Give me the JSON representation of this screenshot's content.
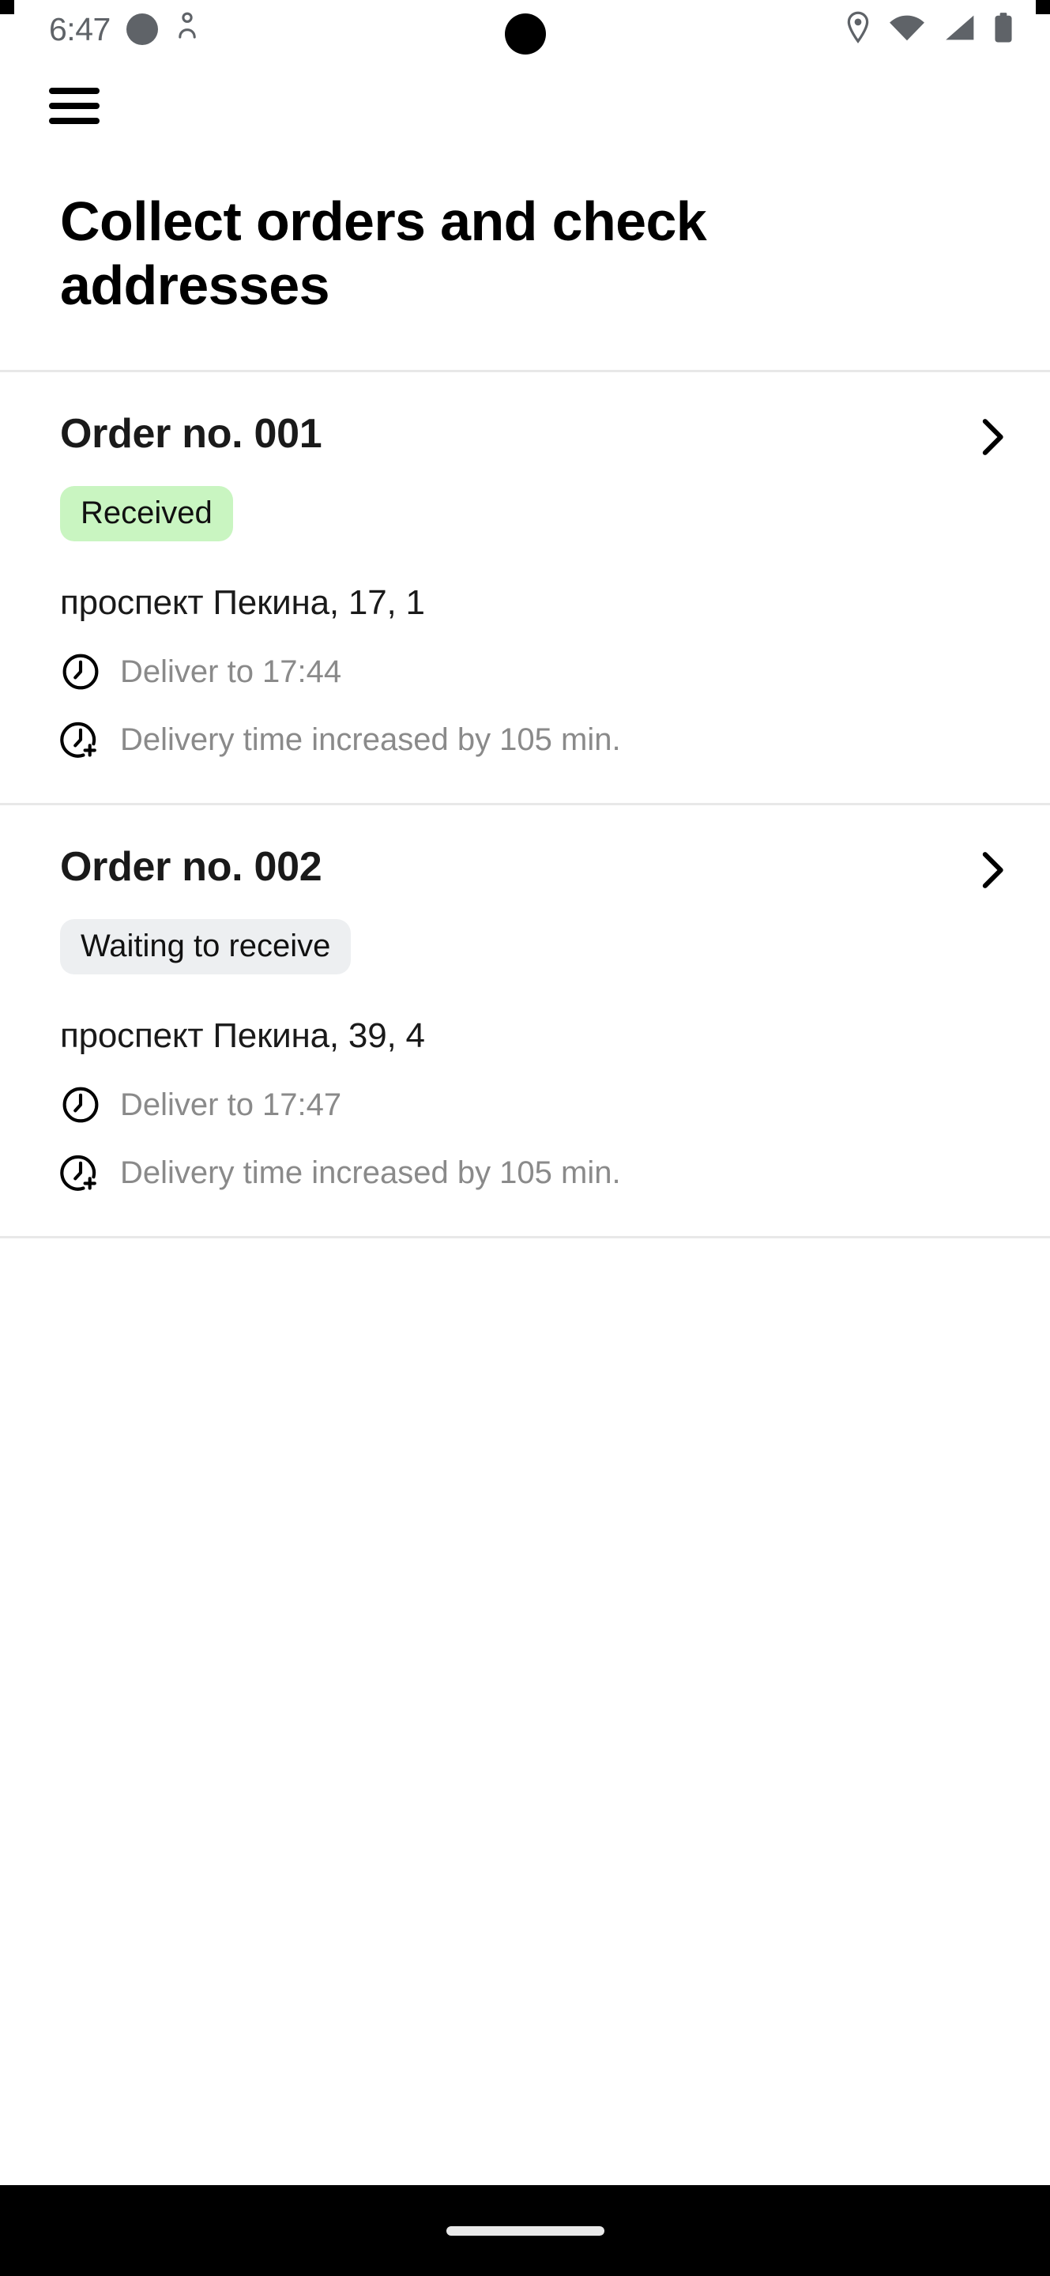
{
  "status_bar": {
    "time": "6:47",
    "icons_left": [
      "circle-indicator-icon",
      "accessibility-icon"
    ],
    "icons_right": [
      "location-pin-icon",
      "wifi-icon",
      "cellular-signal-icon",
      "battery-icon"
    ]
  },
  "app_bar": {
    "menu_icon": "hamburger-menu-icon"
  },
  "page": {
    "title": "Collect orders and check addresses"
  },
  "orders": [
    {
      "number_label": "Order no. 001",
      "status_label": "Received",
      "status_variant": "green",
      "address": "проспект Пекина, 17, 1",
      "deliver_to": "Deliver to 17:44",
      "delay_note": "Delivery time increased by 105 min.",
      "chevron_icon": "chevron-right-icon",
      "clock_icon": "clock-icon",
      "delay_icon": "clock-plus-icon"
    },
    {
      "number_label": "Order no. 002",
      "status_label": "Waiting to receive",
      "status_variant": "grey",
      "address": "проспект Пекина, 39, 4",
      "deliver_to": "Deliver to 17:47",
      "delay_note": "Delivery time increased by 105 min.",
      "chevron_icon": "chevron-right-icon",
      "clock_icon": "clock-icon",
      "delay_icon": "clock-plus-icon"
    }
  ],
  "colors": {
    "badge_green_bg": "#c9f5c1",
    "badge_grey_bg": "#edeff1",
    "divider": "#e8e8e8",
    "muted_text": "#8a8a8a",
    "primary_text": "#1a1a1a",
    "nav_bar_bg": "#000000"
  },
  "nav_bar": {
    "handle": "gesture-handle"
  }
}
